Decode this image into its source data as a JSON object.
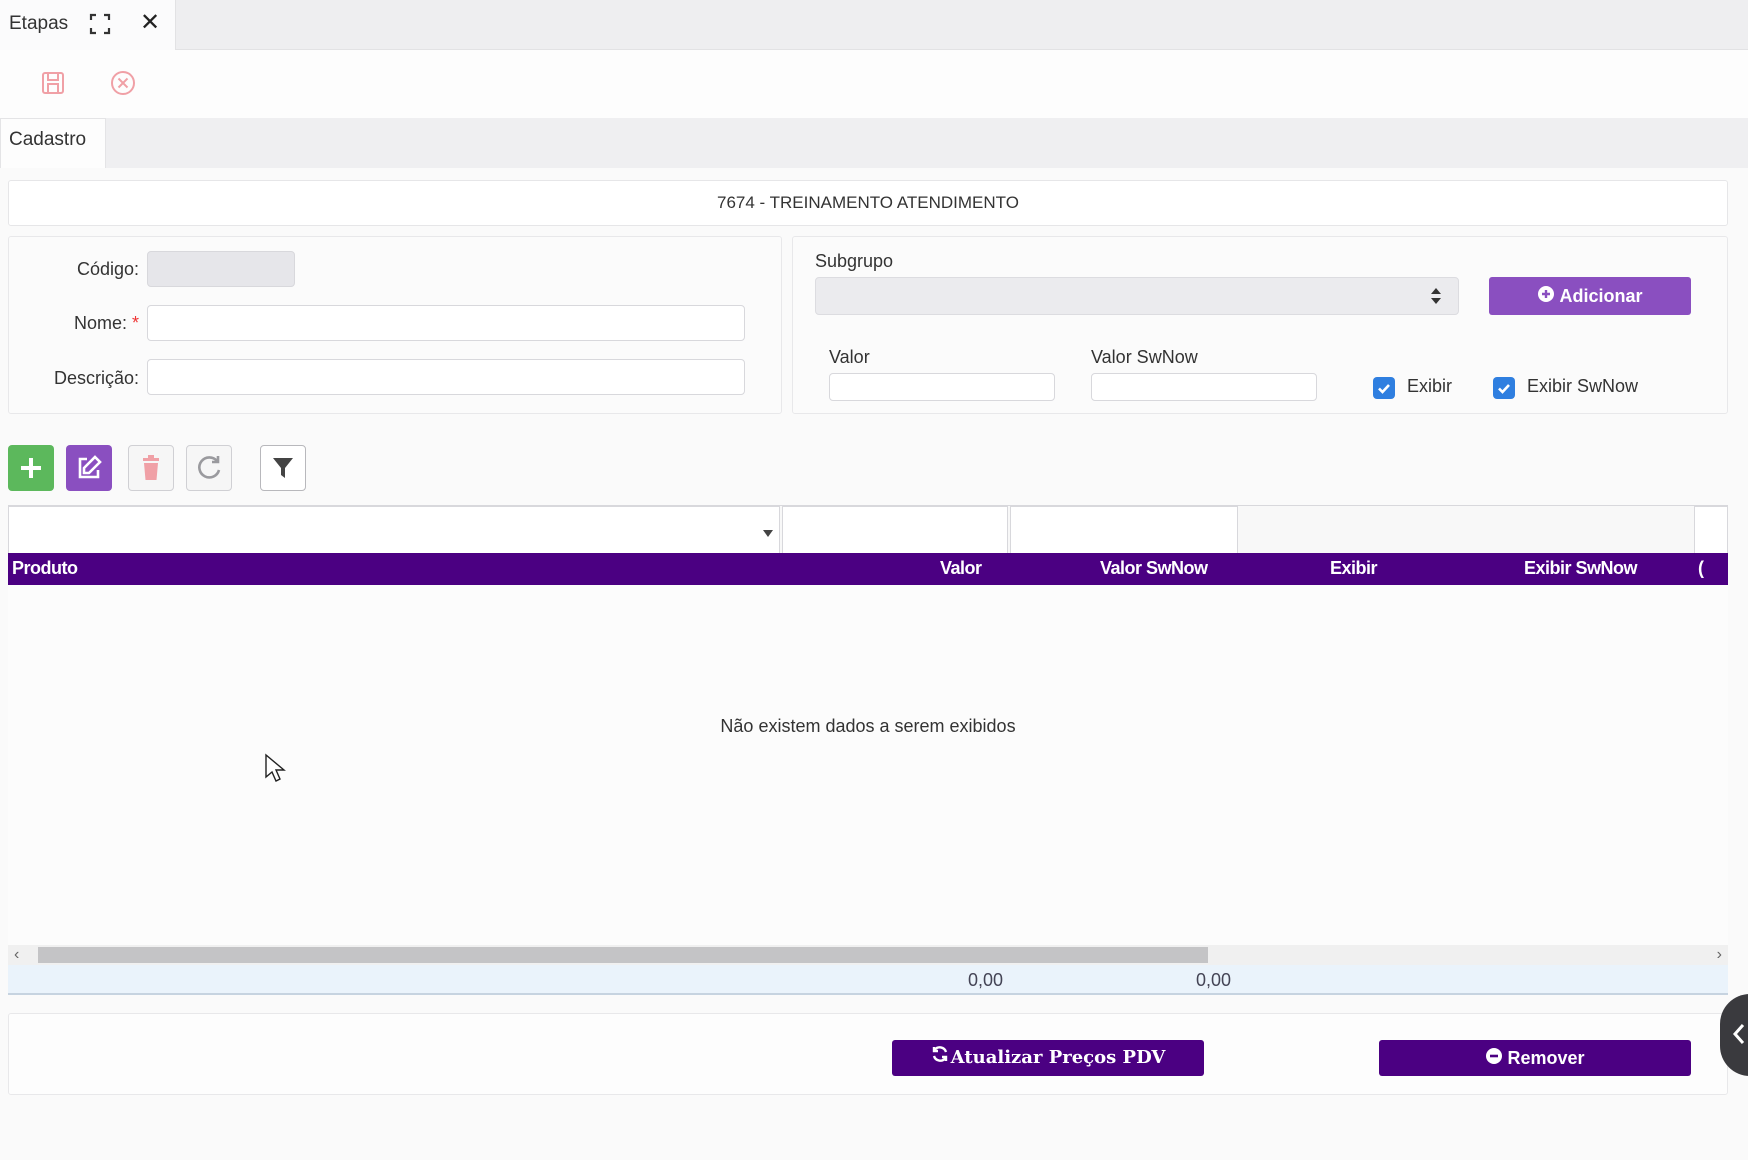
{
  "window": {
    "title": "Etapas"
  },
  "tabs": [
    {
      "label": "Cadastro"
    }
  ],
  "header": {
    "title": "7674 - TREINAMENTO ATENDIMENTO"
  },
  "form": {
    "codigo_label": "Código:",
    "nome_label": "Nome:",
    "required_mark": "*",
    "descricao_label": "Descrição:",
    "codigo_value": "",
    "nome_value": "",
    "descricao_value": ""
  },
  "subgroup": {
    "label": "Subgrupo",
    "selected": "",
    "add_button": "Adicionar",
    "valor_label": "Valor",
    "valor_swnow_label": "Valor SwNow",
    "exibir_label": "Exibir",
    "exibir_swnow_label": "Exibir SwNow",
    "exibir_checked": true,
    "exibir_swnow_checked": true
  },
  "grid": {
    "columns": [
      "Produto",
      "Valor",
      "Valor SwNow",
      "Exibir",
      "Exibir SwNow",
      "("
    ],
    "empty_message": "Não existem dados a serem exibidos",
    "totals": {
      "valor": "0,00",
      "valor_swnow": "0,00"
    }
  },
  "actions": {
    "update_prices": "Atualizar Preços PDV",
    "remove": "Remover"
  },
  "colors": {
    "primary": "#4b0082",
    "accent": "#8a4fc0",
    "success": "#5cb85c",
    "checkbox": "#2f7fe0"
  }
}
